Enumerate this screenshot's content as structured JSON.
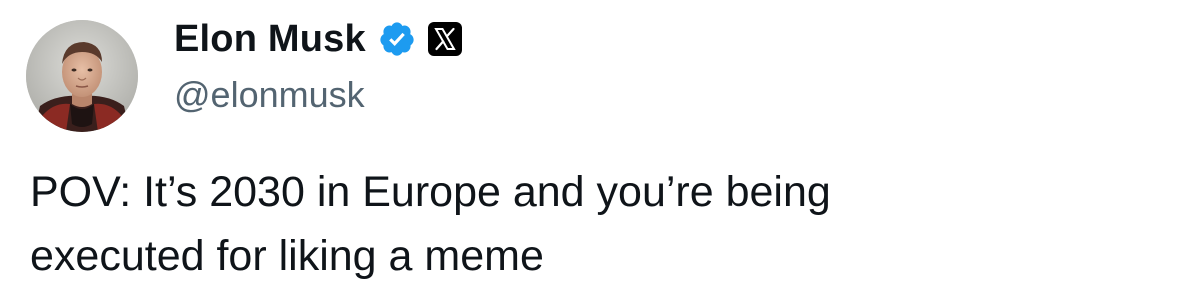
{
  "tweet": {
    "author": {
      "display_name": "Elon Musk",
      "handle": "@elonmusk",
      "verified": true,
      "verified_icon": "verified-badge-icon",
      "platform_icon": "x-logo-icon",
      "avatar": "profile-photo"
    },
    "text": "POV: It’s 2030 in Europe and you’re being\nexecuted for liking a meme"
  },
  "colors": {
    "background": "#ffffff",
    "text_primary": "#0f1419",
    "text_secondary": "#536471",
    "verified_blue": "#1d9bf0",
    "x_logo_bg": "#000000"
  }
}
